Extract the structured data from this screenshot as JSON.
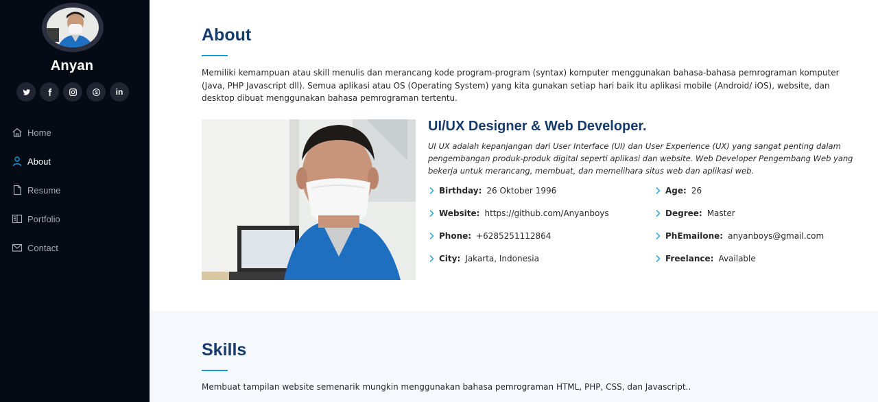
{
  "sidebar": {
    "profile_name": "Anyan",
    "social": [
      {
        "name": "twitter-icon"
      },
      {
        "name": "facebook-icon"
      },
      {
        "name": "instagram-icon"
      },
      {
        "name": "skype-icon"
      },
      {
        "name": "linkedin-icon",
        "label": "in"
      }
    ],
    "nav": [
      {
        "label": "Home",
        "icon": "home-icon",
        "active": false
      },
      {
        "label": "About",
        "icon": "user-icon",
        "active": true
      },
      {
        "label": "Resume",
        "icon": "file-icon",
        "active": false
      },
      {
        "label": "Portfolio",
        "icon": "book-icon",
        "active": false
      },
      {
        "label": "Contact",
        "icon": "envelope-icon",
        "active": false
      }
    ]
  },
  "about": {
    "title": "About",
    "description": "Memiliki kemampuan atau skill menulis dan merancang kode program-program (syntax) komputer menggunakan bahasa-bahasa pemrograman komputer (Java, PHP Javascript dll). Semua aplikasi atau OS (Operating System) yang kita gunakan setiap hari baik itu aplikasi mobile (Android/ iOS), website, dan desktop dibuat menggunakan bahasa pemrograman tertentu.",
    "role_title": "UI/UX Designer & Web Developer.",
    "role_description": "UI UX adalah kepanjangan dari User Interface (UI) dan User Experience (UX) yang sangat penting dalam pengembangan produk-produk digital seperti aplikasi dan website. Web Developer Pengembang Web yang bekerja untuk merancang, membuat, dan memelihara situs web dan aplikasi web.",
    "info": {
      "birthday": {
        "label": "Birthday:",
        "value": "26 Oktober 1996"
      },
      "age": {
        "label": "Age:",
        "value": "26"
      },
      "website": {
        "label": "Website:",
        "value": "https://github.com/Anyanboys"
      },
      "degree": {
        "label": "Degree:",
        "value": "Master"
      },
      "phone": {
        "label": "Phone:",
        "value": "+6285251112864"
      },
      "email": {
        "label": "PhEmailone:",
        "value": "anyanboys@gmail.com"
      },
      "city": {
        "label": "City:",
        "value": "Jakarta, Indonesia"
      },
      "freelance": {
        "label": "Freelance:",
        "value": "Available"
      }
    }
  },
  "skills": {
    "title": "Skills",
    "description": "Membuat tampilan website semenarik mungkin menggunakan bahasa pemrograman HTML, PHP, CSS, dan Javascript.."
  },
  "colors": {
    "sidebar_bg": "#040b14",
    "accent": "#149ddd",
    "heading": "#173b6c",
    "skills_bg": "#f5f8fd"
  }
}
